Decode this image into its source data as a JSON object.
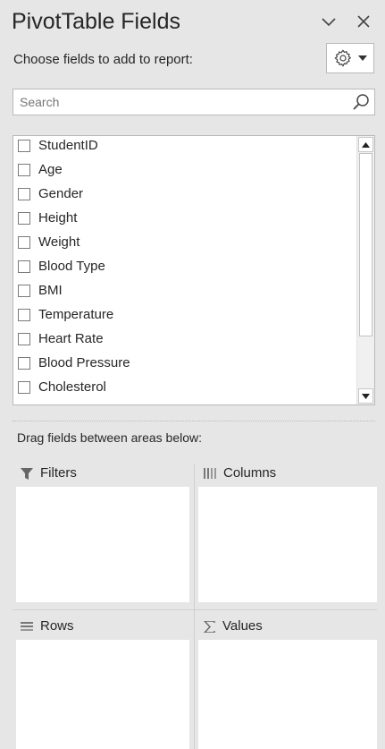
{
  "header": {
    "title": "PivotTable Fields",
    "subtitle": "Choose fields to add to report:"
  },
  "search": {
    "placeholder": "Search",
    "value": ""
  },
  "fields": [
    {
      "label": "StudentID",
      "checked": false
    },
    {
      "label": "Age",
      "checked": false
    },
    {
      "label": "Gender",
      "checked": false
    },
    {
      "label": "Height",
      "checked": false
    },
    {
      "label": "Weight",
      "checked": false
    },
    {
      "label": "Blood Type",
      "checked": false
    },
    {
      "label": "BMI",
      "checked": false
    },
    {
      "label": "Temperature",
      "checked": false
    },
    {
      "label": "Heart Rate",
      "checked": false
    },
    {
      "label": "Blood Pressure",
      "checked": false
    },
    {
      "label": "Cholesterol",
      "checked": false
    }
  ],
  "areas": {
    "instruction": "Drag fields between areas below:",
    "filters": "Filters",
    "columns": "Columns",
    "rows": "Rows",
    "values": "Values"
  },
  "icons": {
    "collapse": "chevron-down-icon",
    "close": "close-icon",
    "tools": "gear-icon",
    "search": "search-icon",
    "filters": "filter-icon",
    "columns": "columns-icon",
    "rows": "rows-icon",
    "values": "sigma-icon"
  }
}
